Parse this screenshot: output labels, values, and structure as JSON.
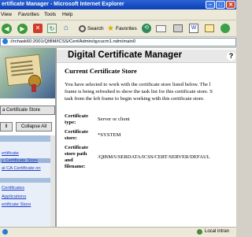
{
  "window": {
    "title": "ertificate Manager - Microsoft Internet Explorer",
    "buttons": {
      "minimize": "–",
      "maximize": "□",
      "close": "✕"
    }
  },
  "menu": [
    "View",
    "Favorites",
    "Tools",
    "Help"
  ],
  "toolbar": {
    "search": "Search",
    "favorites": "Favorites"
  },
  "address": {
    "url": "://rchask60:2001/QIBM/ICSS/Cert/Admin/qycucm1.ndm/main0"
  },
  "left": {
    "select_store_button": "a Certificate Store",
    "expand_all": "ll",
    "collapse_all": "Collapse All",
    "nav_links": [
      "ertificate",
      "y Certificate Store",
      "al CA Certificate on",
      "",
      "Certificates",
      "Applications",
      "ertificate Store"
    ]
  },
  "main": {
    "heading": "Digital Certificate Manager",
    "help": "?",
    "subheading": "Current Certificate Store",
    "paragraph_lines": [
      "You have selected to work with the certificate store listed below. The l",
      "frame is being refreshed to show the task list for this certificate store. S",
      "task from the left frame to begin working with this certificate store."
    ],
    "fields": [
      {
        "label_lines": [
          "Certificate",
          "type:"
        ],
        "value": "Server or client"
      },
      {
        "label_lines": [
          "Certificate",
          "store:"
        ],
        "value": "*SYSTEM"
      },
      {
        "label_lines": [
          "Certificate",
          "store path",
          "and",
          "filename:"
        ],
        "value": "/QIBM/USERDATA/ICSS/CERT/SERVER/DEFAUL"
      }
    ]
  },
  "status": {
    "zone": "Local intran"
  },
  "colors": {
    "titlebar": "#0a3fb5",
    "link": "#1b3cc7",
    "nav_bg": "#e9eff8"
  }
}
